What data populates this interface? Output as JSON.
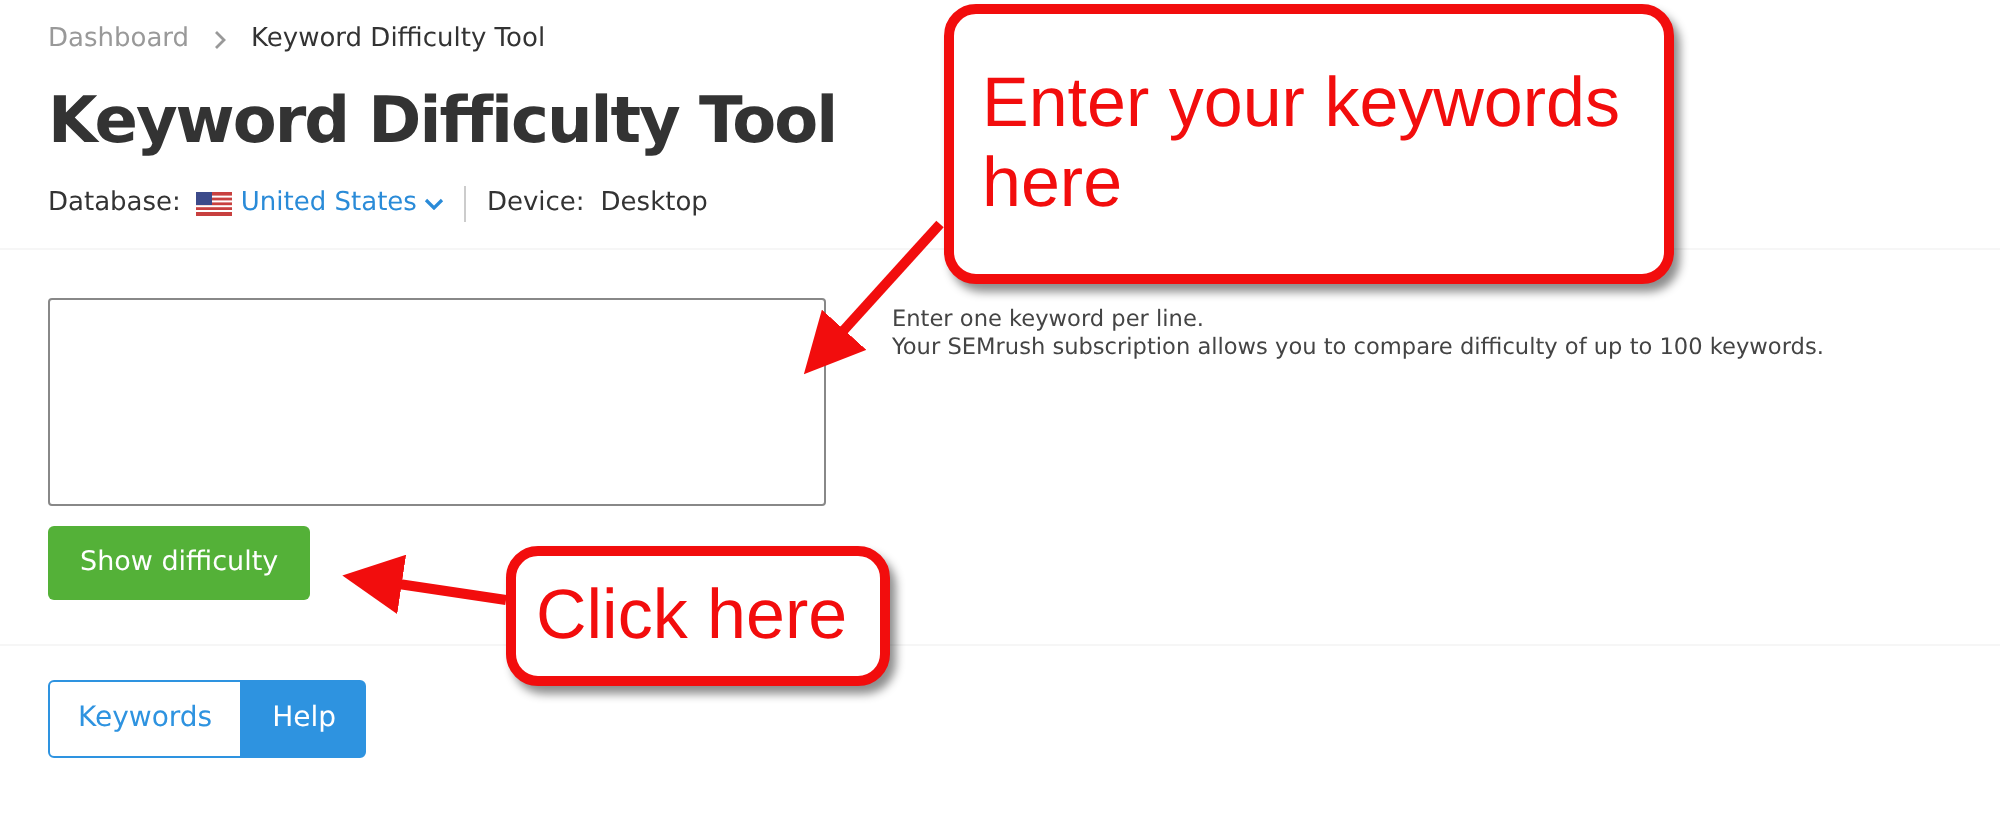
{
  "breadcrumb": [
    {
      "label": "Dashboard",
      "current": false
    },
    {
      "label": "Keyword Difficulty Tool",
      "current": true
    }
  ],
  "title": "Keyword Difficulty Tool",
  "database": {
    "label": "Database:",
    "value": "United States"
  },
  "device": {
    "label": "Device:",
    "value": "Desktop"
  },
  "hints": [
    "Enter one keyword per line.",
    "Your SEMrush subscription allows you to compare difficulty of up to 100 keywords."
  ],
  "submit_button": "Show difficulty",
  "tabs": [
    {
      "label": "Keywords",
      "selected": false
    },
    {
      "label": "Help",
      "selected": true
    }
  ],
  "callouts": [
    {
      "text": "Enter your keywords here"
    },
    {
      "text": "Click here"
    }
  ]
}
